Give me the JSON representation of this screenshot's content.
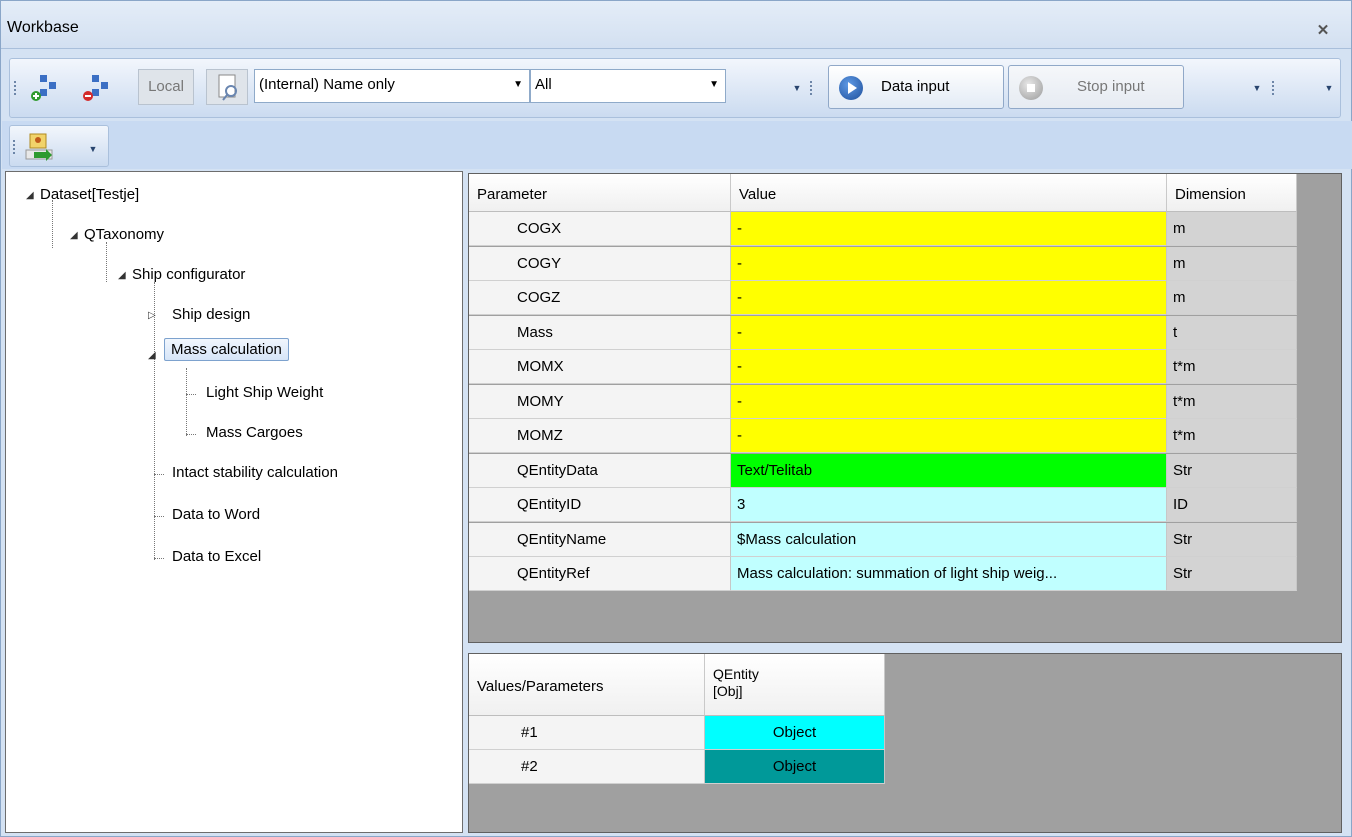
{
  "window": {
    "title": "Workbase"
  },
  "toolbar": {
    "local_label": "Local",
    "name_combo_value": "(Internal) Name only",
    "filter_combo_value": "All",
    "data_input_label": "Data input",
    "stop_input_label": "Stop input"
  },
  "tree": {
    "root": "Dataset[Testje]",
    "taxonomy": "QTaxonomy",
    "configurator": "Ship configurator",
    "ship_design": "Ship design",
    "mass_calculation": "Mass calculation",
    "light_ship_weight": "Light Ship Weight",
    "mass_cargoes": "Mass Cargoes",
    "intact_stability": "Intact stability calculation",
    "data_to_word": "Data to Word",
    "data_to_excel": "Data to Excel"
  },
  "param_grid": {
    "headers": {
      "parameter": "Parameter",
      "value": "Value",
      "dimension": "Dimension"
    },
    "rows": [
      {
        "param": "COGX",
        "value": "-",
        "dim": "m",
        "color": "#ffff00"
      },
      {
        "param": "COGY",
        "value": "-",
        "dim": "m",
        "color": "#ffff00"
      },
      {
        "param": "COGZ",
        "value": "-",
        "dim": "m",
        "color": "#ffff00"
      },
      {
        "param": "Mass",
        "value": "-",
        "dim": "t",
        "color": "#ffff00"
      },
      {
        "param": "MOMX",
        "value": "-",
        "dim": "t*m",
        "color": "#ffff00"
      },
      {
        "param": "MOMY",
        "value": "-",
        "dim": "t*m",
        "color": "#ffff00"
      },
      {
        "param": "MOMZ",
        "value": "-",
        "dim": "t*m",
        "color": "#ffff00"
      },
      {
        "param": "QEntityData",
        "value": "Text/Telitab",
        "dim": "Str",
        "color": "#00ff00"
      },
      {
        "param": "QEntityID",
        "value": "3",
        "dim": "ID",
        "color": "#c0ffff"
      },
      {
        "param": "QEntityName",
        "value": "$Mass calculation",
        "dim": "Str",
        "color": "#c0ffff"
      },
      {
        "param": "QEntityRef",
        "value": "Mass calculation: summation of light ship weig...",
        "dim": "Str",
        "color": "#c0ffff"
      }
    ]
  },
  "values_grid": {
    "headers": {
      "values_parameters": "Values/Parameters",
      "qentity_line1": "QEntity",
      "qentity_line2": "[Obj]"
    },
    "rows": [
      {
        "label": "#1",
        "value": "Object",
        "color": "#00ffff"
      },
      {
        "label": "#2",
        "value": "Object",
        "color": "#009999"
      }
    ]
  }
}
